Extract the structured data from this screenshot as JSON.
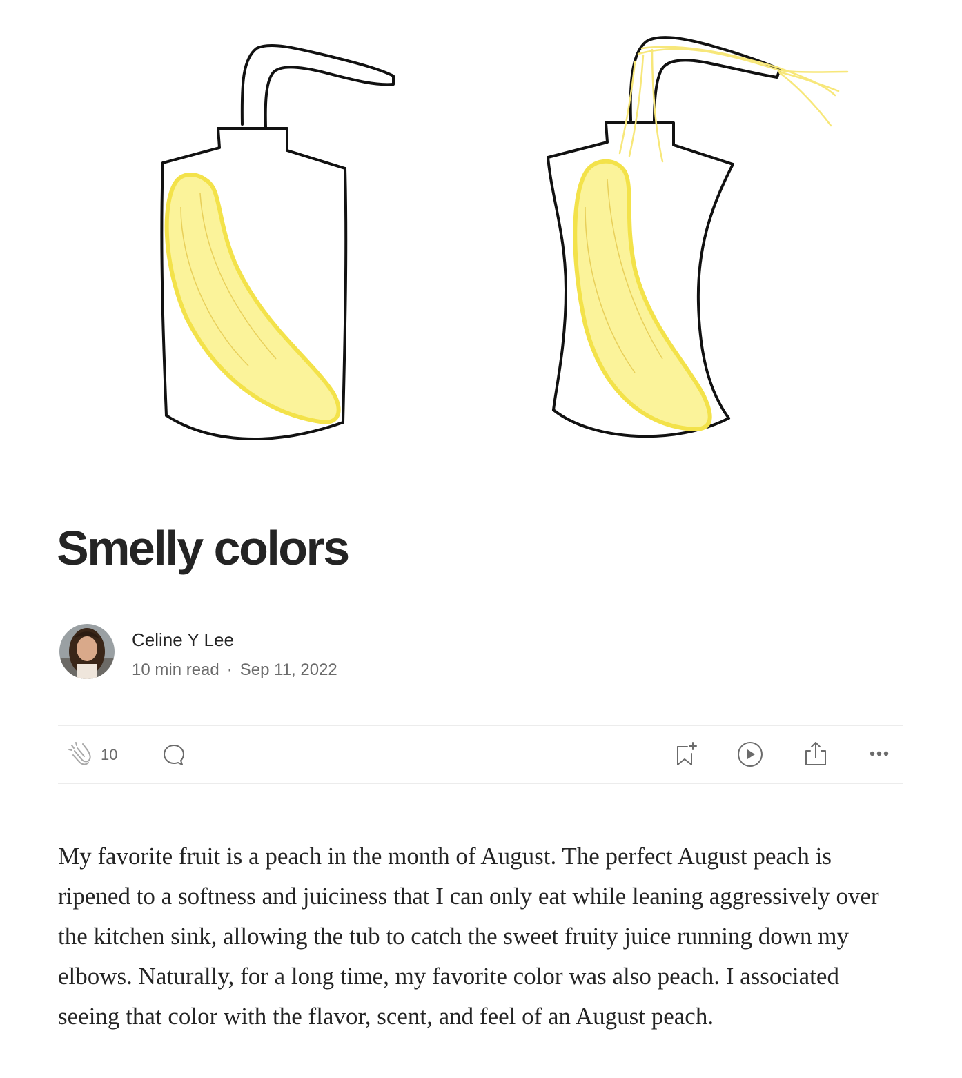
{
  "article": {
    "title": "Smelly colors",
    "author_name": "Celine Y Lee",
    "read_time": "10 min read",
    "separator": "·",
    "date": "Sep 11, 2022",
    "clap_count": "10",
    "paragraph": "My favorite fruit is a peach in the month of August. The perfect August peach is ripened to a softness and juiciness that I can only eat while leaning aggressively over the kitchen sink, allowing the tub to catch the sweet fruity juice running down my elbows. Naturally, for a long time, my favorite color was also peach. I associated seeing that color with the flavor, scent, and feel of an August peach."
  },
  "icons": {
    "clap": "clap-icon",
    "comment": "comment-icon",
    "bookmark": "bookmark-add-icon",
    "listen": "play-icon",
    "share": "share-icon",
    "more": "more-dots-icon"
  },
  "colors": {
    "text": "#242424",
    "muted": "#6b6b6b",
    "divider": "#ececec",
    "banana_fill": "#fbf39a",
    "banana_stroke": "#f3e24a"
  }
}
